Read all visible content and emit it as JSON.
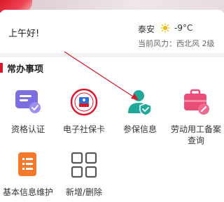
{
  "greeting": "上午好!",
  "weather": {
    "city": "泰安",
    "temperature": "-9°C",
    "wind": "当前风力：西北风 2级",
    "icon": "sun-icon"
  },
  "section": {
    "title": "常办事项"
  },
  "tiles": [
    {
      "label": "资格认证",
      "icon": "certification-icon"
    },
    {
      "label": "电子社保卡",
      "icon": "social-security-card-icon"
    },
    {
      "label": "参保信息",
      "icon": "insured-person-icon"
    },
    {
      "label": "劳动用工备案查询",
      "icon": "employment-filing-icon"
    },
    {
      "label": "基本信息维护",
      "icon": "basic-info-icon"
    },
    {
      "label": "新增/删除",
      "icon": "add-remove-grid-icon"
    }
  ],
  "colors": {
    "accent": "#d9192b",
    "teal": "#1fa99b",
    "purple": "#7b6fe0",
    "pink": "#e94c76",
    "orange": "#f5792a"
  }
}
